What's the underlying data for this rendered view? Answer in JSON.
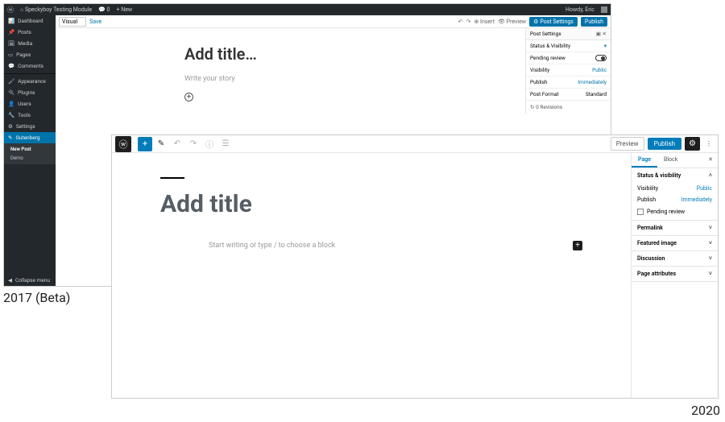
{
  "labels": {
    "y2017": "2017 (Beta)",
    "y2020": "2020"
  },
  "w2017": {
    "adminbar": {
      "site": "Speckyboy Testing Module",
      "comments": "0",
      "new": "New",
      "howdy": "Howdy, Eric"
    },
    "sidebar": {
      "items": [
        {
          "icon": "⌂",
          "label": "Dashboard"
        },
        {
          "icon": "📌",
          "label": "Posts"
        },
        {
          "icon": "🖼",
          "label": "Media"
        },
        {
          "icon": "▭",
          "label": "Pages"
        },
        {
          "icon": "💬",
          "label": "Comments"
        },
        {
          "icon": "sep",
          "label": ""
        },
        {
          "icon": "🖌",
          "label": "Appearance"
        },
        {
          "icon": "🔌",
          "label": "Plugins"
        },
        {
          "icon": "👤",
          "label": "Users"
        },
        {
          "icon": "🔧",
          "label": "Tools"
        },
        {
          "icon": "⚙",
          "label": "Settings"
        },
        {
          "icon": "✎",
          "label": "Gutenberg",
          "active": true
        }
      ],
      "sub": [
        {
          "label": "New Post",
          "bold": true
        },
        {
          "label": "Demo"
        }
      ],
      "collapse": "Collapse menu"
    },
    "toolbar": {
      "mode": "Visual",
      "save": "Save",
      "preview": "Preview",
      "settings": "Post Settings",
      "publish": "Publish"
    },
    "canvas": {
      "title": "Add title…",
      "story": "Write your story"
    },
    "panel": {
      "header": "Post Settings",
      "rows": [
        {
          "k": "Status & Visibility",
          "v": ""
        },
        {
          "k": "Pending review",
          "v": "toggle"
        },
        {
          "k": "Visibility",
          "v": "Public"
        },
        {
          "k": "Publish",
          "v": "Immediately"
        },
        {
          "k": "Post Format",
          "v": "Standard"
        }
      ],
      "revisions": "0 Revisions"
    }
  },
  "w2020": {
    "toolbar": {
      "preview": "Preview",
      "publish": "Publish"
    },
    "canvas": {
      "title": "Add title",
      "prompt": "Start writing or type / to choose a block"
    },
    "panel": {
      "tabs": {
        "page": "Page",
        "block": "Block"
      },
      "status": {
        "header": "Status & visibility",
        "visibility_k": "Visibility",
        "visibility_v": "Public",
        "publish_k": "Publish",
        "publish_v": "Immediately",
        "pending": "Pending review"
      },
      "sections": [
        "Permalink",
        "Featured image",
        "Discussion",
        "Page attributes"
      ]
    }
  }
}
